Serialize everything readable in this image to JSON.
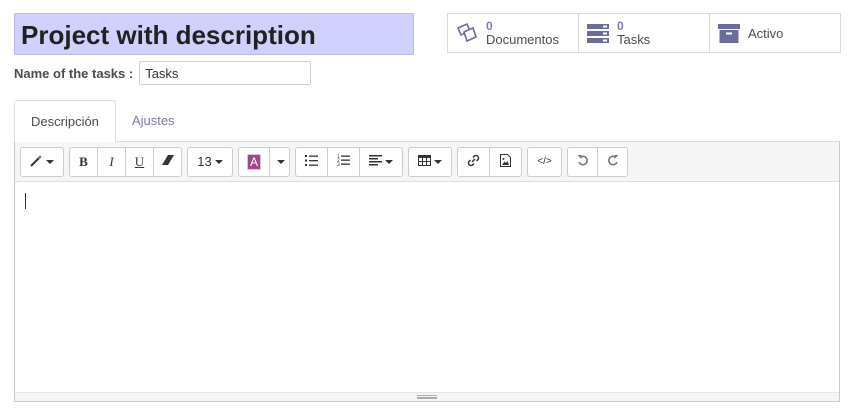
{
  "project": {
    "title": "Project with description",
    "tasks_name_label": "Name of the tasks :",
    "tasks_name_value": "Tasks"
  },
  "stat_buttons": {
    "documents": {
      "count": "0",
      "label": "Documentos",
      "icon": "documents-icon"
    },
    "tasks": {
      "count": "0",
      "label": "Tasks",
      "icon": "tasks-icon"
    },
    "active": {
      "label": "Activo",
      "icon": "archive-icon"
    }
  },
  "tabs": [
    {
      "label": "Descripción",
      "active": true
    },
    {
      "label": "Ajustes",
      "active": false
    }
  ],
  "toolbar": {
    "style_icon": "magic-wand-icon",
    "bold": "B",
    "italic": "I",
    "underline": "U",
    "eraser_icon": "eraser-icon",
    "font_size": "13",
    "color_letter": "A",
    "unordered_list_icon": "list-ul-icon",
    "ordered_list_icon": "list-ol-icon",
    "align_icon": "align-left-icon",
    "table_icon": "table-icon",
    "link_icon": "link-icon",
    "image_icon": "image-icon",
    "code_label": "</>",
    "undo_icon": "undo-icon",
    "redo_icon": "redo-icon"
  },
  "colors": {
    "title_bg": "#cfd0fb",
    "accent": "#7c7bad",
    "color_swatch": "#a24689"
  }
}
